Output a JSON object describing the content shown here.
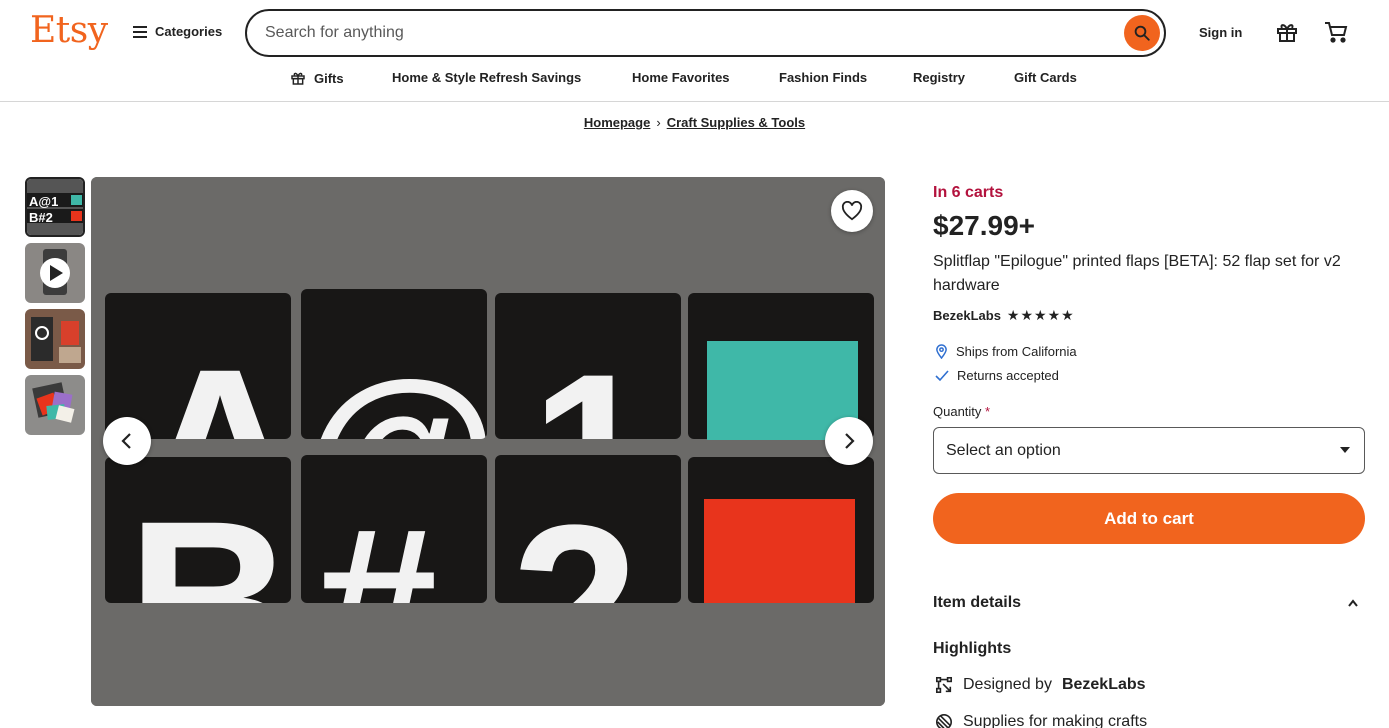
{
  "header": {
    "logo": "Etsy",
    "categories_label": "Categories",
    "search_placeholder": "Search for anything",
    "signin_label": "Sign in"
  },
  "nav": {
    "items": [
      "Gifts",
      "Home & Style Refresh Savings",
      "Home Favorites",
      "Fashion Finds",
      "Registry",
      "Gift Cards"
    ]
  },
  "breadcrumb": {
    "items": [
      "Homepage",
      "Craft Supplies & Tools"
    ],
    "separator": "›"
  },
  "listing": {
    "in_carts": "In 6 carts",
    "price": "$27.99+",
    "title": "Splitflap \"Epilogue\" printed flaps [BETA]: 52 flap set for v2 hardware",
    "shop_name": "BezekLabs",
    "rating_stars": "★★★★★",
    "ships_from": "Ships from California",
    "returns": "Returns accepted",
    "quantity_label": "Quantity",
    "required_mark": "*",
    "quantity_value": "Select an option",
    "add_to_cart": "Add to cart",
    "item_details": "Item details",
    "highlights_title": "Highlights",
    "designed_by_prefix": "Designed by",
    "designed_by_shop": "BezekLabs",
    "supplies": "Supplies for making crafts"
  },
  "image": {
    "flap_letters_top": [
      "A",
      "@",
      "1"
    ],
    "flap_letters_bottom": [
      "B",
      "#",
      "2"
    ]
  },
  "colors": {
    "brand": "#f1641e",
    "cart_alert": "#b3123d",
    "flap_teal": "#3fb8a8",
    "flap_red": "#e8341c"
  }
}
